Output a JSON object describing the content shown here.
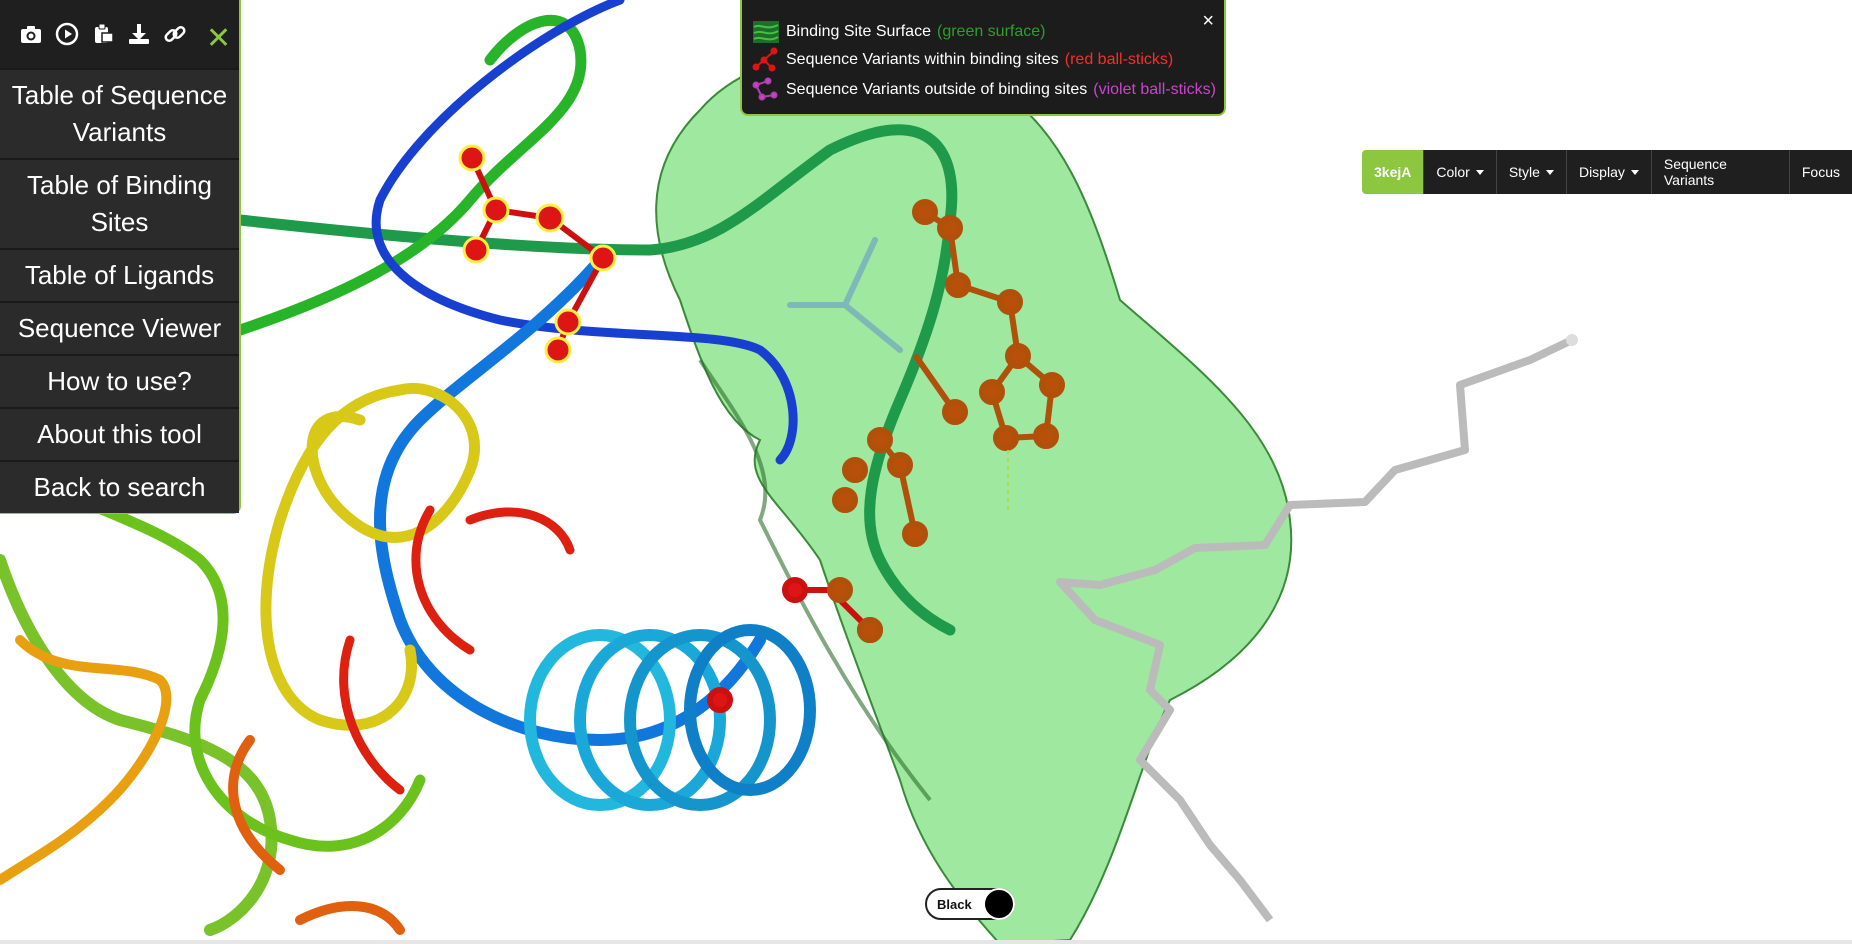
{
  "toolbar": {
    "icons": [
      "camera-icon",
      "play-icon",
      "clipboard-icon",
      "download-icon",
      "link-icon",
      "close-icon"
    ]
  },
  "menu": {
    "items": [
      "Table of Sequence Variants",
      "Table of Binding Sites",
      "Table of Ligands",
      "Sequence Viewer",
      "How to use?",
      "About this tool",
      "Back to search"
    ]
  },
  "legend": {
    "surface_label": "Binding Site Surface",
    "surface_note": "(green surface)",
    "inside_label": "Sequence Variants within binding sites",
    "inside_note": "(red ball-sticks)",
    "outside_label": "Sequence Variants outside of binding sites",
    "outside_note": "(violet ball-sticks)",
    "close": "×"
  },
  "controls": {
    "pdb_id": "3kejA",
    "color": "Color",
    "style": "Style",
    "display": "Display",
    "sequence_variants": "Sequence Variants",
    "focus": "Focus"
  },
  "background_toggle": {
    "label": "Black"
  },
  "colors": {
    "accent": "#8dc63f",
    "surface_note": "#2ca02c",
    "inside_note": "#ff2a2a",
    "outside_note": "#cc44cc"
  }
}
